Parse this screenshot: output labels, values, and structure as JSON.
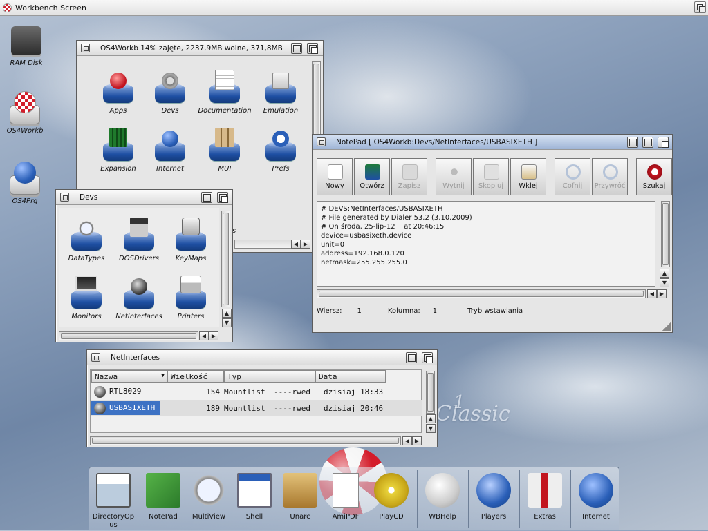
{
  "screen": {
    "title": "Workbench Screen"
  },
  "desktop_icons": [
    {
      "label": "RAM Disk"
    },
    {
      "label": "OS4Workb"
    },
    {
      "label": "OS4Prg"
    }
  ],
  "win_os4": {
    "title": "OS4Workb  14% zajęte, 2237,9MB wolne, 371,8MB",
    "icons": [
      "Apps",
      "Devs",
      "Documentation",
      "Emulation",
      "Expansion",
      "Internet",
      "MUI",
      "Prefs"
    ],
    "partial_label": "s"
  },
  "win_devs": {
    "title": "Devs",
    "icons": [
      "DataTypes",
      "DOSDrivers",
      "KeyMaps",
      "Monitors",
      "NetInterfaces",
      "Printers"
    ]
  },
  "notepad": {
    "title": "NotePad [ OS4Workb:Devs/NetInterfaces/USBASIXETH ]",
    "toolbar": [
      {
        "label": "Nowy",
        "enabled": true
      },
      {
        "label": "Otwórz",
        "enabled": true
      },
      {
        "label": "Zapisz",
        "enabled": false
      },
      {
        "label": "Wytnij",
        "enabled": false
      },
      {
        "label": "Skopiuj",
        "enabled": false
      },
      {
        "label": "Wklej",
        "enabled": true
      },
      {
        "label": "Cofnij",
        "enabled": false
      },
      {
        "label": "Przywróć",
        "enabled": false
      },
      {
        "label": "Szukaj",
        "enabled": true
      }
    ],
    "content": "# DEVS:NetInterfaces/USBASIXETH\n# File generated by Dialer 53.2 (3.10.2009)\n# On środa, 25-lip-12    at 20:46:15\ndevice=usbasixeth.device\nunit=0\naddress=192.168.0.120\nnetmask=255.255.255.0",
    "status": {
      "row_label": "Wiersz:",
      "row": "1",
      "col_label": "Kolumna:",
      "col": "1",
      "mode": "Tryb wstawiania"
    }
  },
  "netinterfaces": {
    "title": "NetInterfaces",
    "columns": [
      "Nazwa",
      "Wielkość",
      "Typ",
      "Data"
    ],
    "rows": [
      {
        "name": "RTL8029",
        "size": "154",
        "type": "Mountlist",
        "prot": "----rwed",
        "date": "dzisiaj 18:33",
        "selected": false
      },
      {
        "name": "USBASIXETH",
        "size": "189",
        "type": "Mountlist",
        "prot": "----rwed",
        "date": "dzisiaj 20:46",
        "selected": true
      }
    ]
  },
  "dock": {
    "items": [
      "DirectoryOpus",
      "NotePad",
      "MultiView",
      "Shell",
      "Unarc",
      "AmiPDF",
      "PlayCD",
      "WBHelp",
      "Players",
      "Extras",
      "Internet"
    ]
  },
  "branding": {
    "text": "Classic",
    "superscript": "1"
  },
  "colors": {
    "selection": "#3d72c4",
    "tray_blue": "#1e4fa3",
    "boing_red": "#d21e2b"
  }
}
